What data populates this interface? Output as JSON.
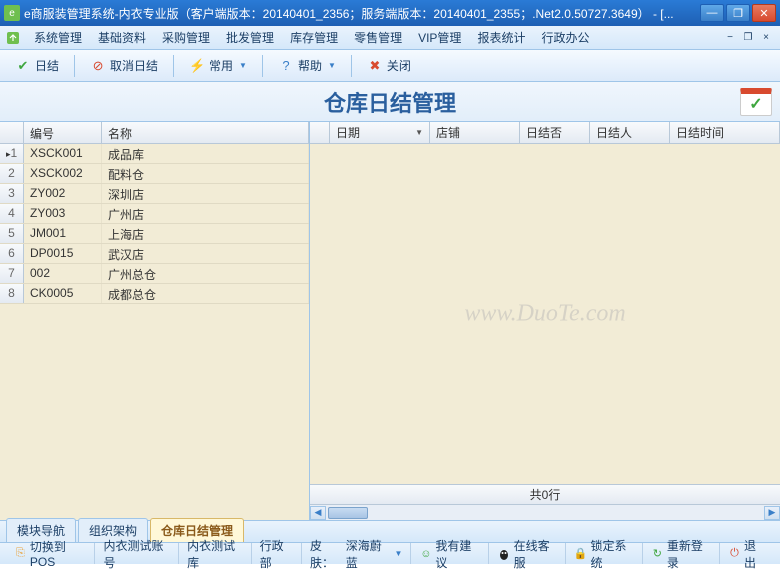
{
  "window": {
    "title": "e商服装管理系统-内衣专业版（客户端版本：20140401_2356；服务端版本：20140401_2355；.Net2.0.50727.3649） - [..."
  },
  "menu": {
    "items": [
      "系统管理",
      "基础资料",
      "采购管理",
      "批发管理",
      "库存管理",
      "零售管理",
      "VIP管理",
      "报表统计",
      "行政办公"
    ]
  },
  "toolbar": {
    "daily_close": "日结",
    "cancel_close": "取消日结",
    "common": "常用",
    "help": "帮助",
    "close": "关闭"
  },
  "header": {
    "title": "仓库日结管理"
  },
  "left_grid": {
    "columns": {
      "code": "编号",
      "name": "名称"
    },
    "rows": [
      {
        "idx": "1",
        "code": "XSCK001",
        "name": "成品库",
        "selected": true
      },
      {
        "idx": "2",
        "code": "XSCK002",
        "name": "配料仓"
      },
      {
        "idx": "3",
        "code": "ZY002",
        "name": "深圳店"
      },
      {
        "idx": "4",
        "code": "ZY003",
        "name": "广州店"
      },
      {
        "idx": "5",
        "code": "JM001",
        "name": "上海店"
      },
      {
        "idx": "6",
        "code": "DP0015",
        "name": "武汉店"
      },
      {
        "idx": "7",
        "code": "002",
        "name": "广州总仓"
      },
      {
        "idx": "8",
        "code": "CK0005",
        "name": "成都总仓"
      }
    ]
  },
  "right_grid": {
    "columns": {
      "date": "日期",
      "store": "店铺",
      "closed": "日结否",
      "person": "日结人",
      "time": "日结时间"
    },
    "footer": "共0行"
  },
  "watermark": "www.DuoTe.com",
  "bottom_tabs": {
    "items": [
      {
        "label": "模块导航",
        "active": false
      },
      {
        "label": "组织架构",
        "active": false
      },
      {
        "label": "仓库日结管理",
        "active": true
      }
    ]
  },
  "status": {
    "switch_pos": "切换到POS",
    "acct": "内衣测试账号",
    "warehouse": "内衣测试库",
    "dept": "行政部",
    "skin_label": "皮肤：",
    "skin_value": "深海蔚蓝",
    "suggest": "我有建议",
    "service": "在线客服",
    "lock": "锁定系统",
    "relogin": "重新登录",
    "exit": "退出"
  }
}
